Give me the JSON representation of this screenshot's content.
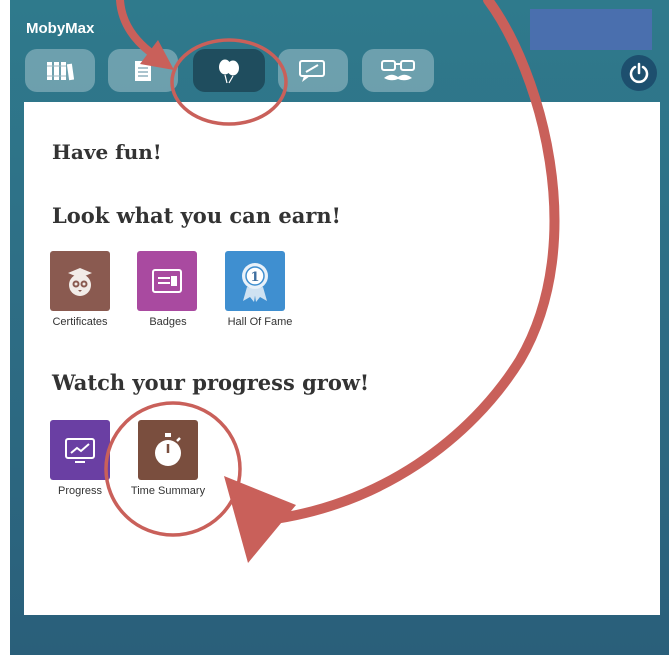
{
  "app": {
    "title": "MobyMax"
  },
  "nav": {
    "items": [
      {
        "icon": "library-icon",
        "active": false
      },
      {
        "icon": "assignments-icon",
        "active": false
      },
      {
        "icon": "balloons-icon",
        "active": true
      },
      {
        "icon": "messages-icon",
        "active": false
      },
      {
        "icon": "avatar-glasses-icon",
        "active": false
      }
    ]
  },
  "header": {
    "power_icon": "power-icon"
  },
  "main": {
    "have_fun": "Have fun!",
    "earn_heading": "Look what you can earn!",
    "earn_items": [
      {
        "label": "Certificates",
        "icon": "certificate-owl-icon",
        "color": "#8a5a50"
      },
      {
        "label": "Badges",
        "icon": "badge-icon",
        "color": "#a94aa0"
      },
      {
        "label": "Hall Of Fame",
        "icon": "ribbon-icon",
        "color": "#3f8fd0"
      }
    ],
    "progress_heading": "Watch your progress grow!",
    "progress_items": [
      {
        "label": "Progress",
        "icon": "chart-icon",
        "color": "#6a3fa3"
      },
      {
        "label": "Time Summary",
        "icon": "stopwatch-icon",
        "color": "#7a4e3e"
      }
    ]
  },
  "annotations": {
    "color": "#c9605a",
    "items": [
      "circle-highlight",
      "curved-arrow"
    ]
  }
}
